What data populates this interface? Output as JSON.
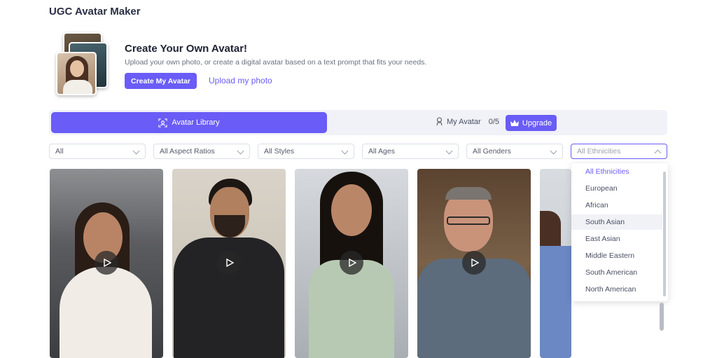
{
  "app": {
    "title": "UGC Avatar Maker"
  },
  "hero": {
    "title": "Create Your Own Avatar!",
    "subtitle": "Upload your own photo, or create a digital avatar based on a text prompt that fits your needs.",
    "create_button": "Create My Avatar",
    "upload_link": "Upload my photo"
  },
  "tabs": {
    "library_label": "Avatar Library",
    "my_avatar_label": "My Avatar",
    "my_avatar_count": "0/5",
    "upgrade_label": "Upgrade"
  },
  "filters": [
    {
      "label": "All"
    },
    {
      "label": "All Aspect Ratios"
    },
    {
      "label": "All Styles"
    },
    {
      "label": "All Ages"
    },
    {
      "label": "All Genders"
    },
    {
      "label": "All Ethnicities"
    }
  ],
  "ethnicity_dropdown": {
    "options": [
      "All Ethnicities",
      "European",
      "African",
      "South Asian",
      "East Asian",
      "Middle Eastern",
      "South American",
      "North American"
    ],
    "selected": "All Ethnicities",
    "hovered": "South Asian"
  },
  "colors": {
    "accent": "#6a5cf6"
  }
}
